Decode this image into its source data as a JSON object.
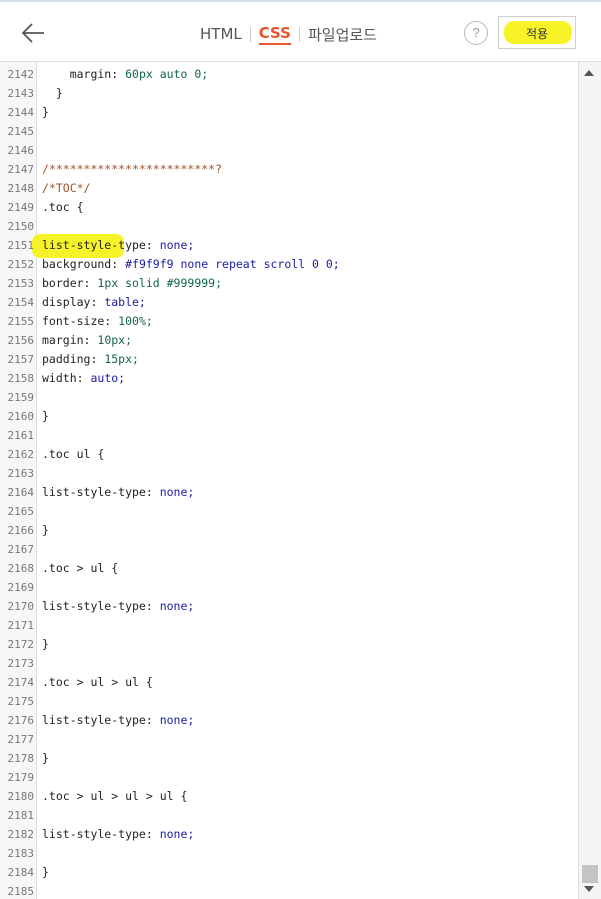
{
  "header": {
    "tabs": [
      {
        "label": "HTML",
        "active": false
      },
      {
        "label": "CSS",
        "active": true
      },
      {
        "label": "파일업로드",
        "active": false
      }
    ],
    "help_label": "?",
    "apply_label": "적용",
    "back_icon": "arrow-left-icon"
  },
  "editor": {
    "lines": [
      {
        "num": "2142",
        "code": "    margin: 60px auto 0;"
      },
      {
        "num": "2143",
        "code": "  }"
      },
      {
        "num": "2144",
        "code": "}"
      },
      {
        "num": "2145",
        "code": ""
      },
      {
        "num": "2146",
        "code": ""
      },
      {
        "num": "2147",
        "code": "/************************?"
      },
      {
        "num": "2148",
        "code": "/*TOC*/"
      },
      {
        "num": "2149",
        "code": ".toc {"
      },
      {
        "num": "2150",
        "code": ""
      },
      {
        "num": "2151",
        "code": "list-style-type: none;"
      },
      {
        "num": "2152",
        "code": "background: #f9f9f9 none repeat scroll 0 0;"
      },
      {
        "num": "2153",
        "code": "border: 1px solid #999999;"
      },
      {
        "num": "2154",
        "code": "display: table;"
      },
      {
        "num": "2155",
        "code": "font-size: 100%;"
      },
      {
        "num": "2156",
        "code": "margin: 10px;"
      },
      {
        "num": "2157",
        "code": "padding: 15px;"
      },
      {
        "num": "2158",
        "code": "width: auto;"
      },
      {
        "num": "2159",
        "code": ""
      },
      {
        "num": "2160",
        "code": "}"
      },
      {
        "num": "2161",
        "code": ""
      },
      {
        "num": "2162",
        "code": ".toc ul {"
      },
      {
        "num": "2163",
        "code": ""
      },
      {
        "num": "2164",
        "code": "list-style-type: none;"
      },
      {
        "num": "2165",
        "code": ""
      },
      {
        "num": "2166",
        "code": "}"
      },
      {
        "num": "2167",
        "code": ""
      },
      {
        "num": "2168",
        "code": ".toc > ul {"
      },
      {
        "num": "2169",
        "code": ""
      },
      {
        "num": "2170",
        "code": "list-style-type: none;"
      },
      {
        "num": "2171",
        "code": ""
      },
      {
        "num": "2172",
        "code": "}"
      },
      {
        "num": "2173",
        "code": ""
      },
      {
        "num": "2174",
        "code": ".toc > ul > ul {"
      },
      {
        "num": "2175",
        "code": ""
      },
      {
        "num": "2176",
        "code": "list-style-type: none;"
      },
      {
        "num": "2177",
        "code": ""
      },
      {
        "num": "2178",
        "code": "}"
      },
      {
        "num": "2179",
        "code": ""
      },
      {
        "num": "2180",
        "code": ".toc > ul > ul > ul {"
      },
      {
        "num": "2181",
        "code": ""
      },
      {
        "num": "2182",
        "code": "list-style-type: none;"
      },
      {
        "num": "2183",
        "code": ""
      },
      {
        "num": "2184",
        "code": "}"
      },
      {
        "num": "2185",
        "code": ""
      }
    ]
  },
  "highlight_color": "#f5f31e",
  "accent_color": "#e8552a"
}
